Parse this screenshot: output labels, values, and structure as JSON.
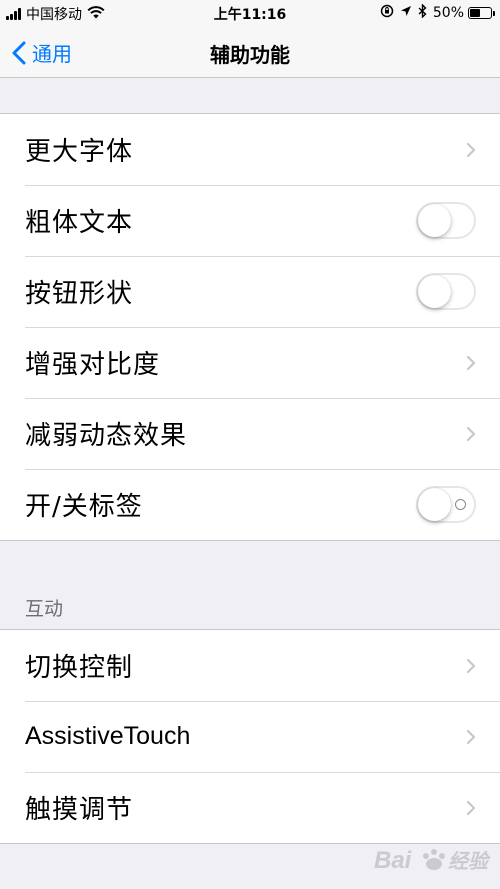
{
  "status_bar": {
    "carrier": "中国移动",
    "time": "上午11:16",
    "battery_percent": "50%",
    "battery_level": 0.5,
    "icons": [
      "signal-icon",
      "wifi-icon",
      "orientation-lock-icon",
      "location-icon",
      "bluetooth-icon",
      "battery-icon"
    ]
  },
  "nav": {
    "back_label": "通用",
    "title": "辅助功能"
  },
  "groups": [
    {
      "items": [
        {
          "label": "更大字体",
          "accessory": "chevron"
        },
        {
          "label": "粗体文本",
          "accessory": "toggle",
          "value": false
        },
        {
          "label": "按钮形状",
          "accessory": "toggle",
          "value": false
        },
        {
          "label": "增强对比度",
          "accessory": "chevron"
        },
        {
          "label": "减弱动态效果",
          "accessory": "chevron"
        },
        {
          "label": "开/关标签",
          "accessory": "toggle",
          "value": false
        }
      ]
    },
    {
      "header": "互动",
      "items": [
        {
          "label": "切换控制",
          "accessory": "chevron"
        },
        {
          "label": "AssistiveTouch",
          "accessory": "chevron"
        },
        {
          "label": "触摸调节",
          "accessory": "chevron"
        }
      ]
    }
  ],
  "watermark": "Bai经验",
  "colors": {
    "accent": "#007aff",
    "background": "#efeff4",
    "separator": "#c8c7cc",
    "chevron": "#c7c7cc"
  }
}
